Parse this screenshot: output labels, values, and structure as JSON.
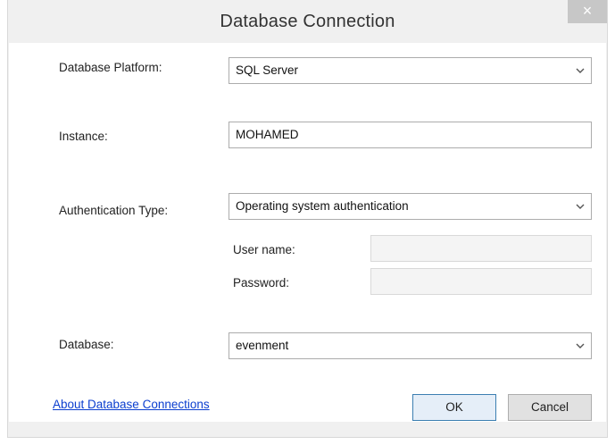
{
  "window": {
    "title": "Database Connection",
    "close_glyph": "×"
  },
  "form": {
    "platform_label": "Database Platform:",
    "platform_value": "SQL Server",
    "instance_label": "Instance:",
    "instance_value": "MOHAMED",
    "auth_label": "Authentication Type:",
    "auth_value": "Operating system authentication",
    "username_label": "User name:",
    "username_value": "",
    "password_label": "Password:",
    "password_value": "",
    "database_label": "Database:",
    "database_value": "evenment"
  },
  "footer": {
    "about_link": "About Database Connections",
    "ok_label": "OK",
    "cancel_label": "Cancel"
  },
  "icons": {
    "dropdown": "chevron-down-icon",
    "close": "close-icon"
  },
  "colors": {
    "link": "#0b3ecf",
    "close_button_bg": "#c7c7c7",
    "dialog_bg": "#f0f0f0",
    "content_bg": "#ffffff"
  }
}
